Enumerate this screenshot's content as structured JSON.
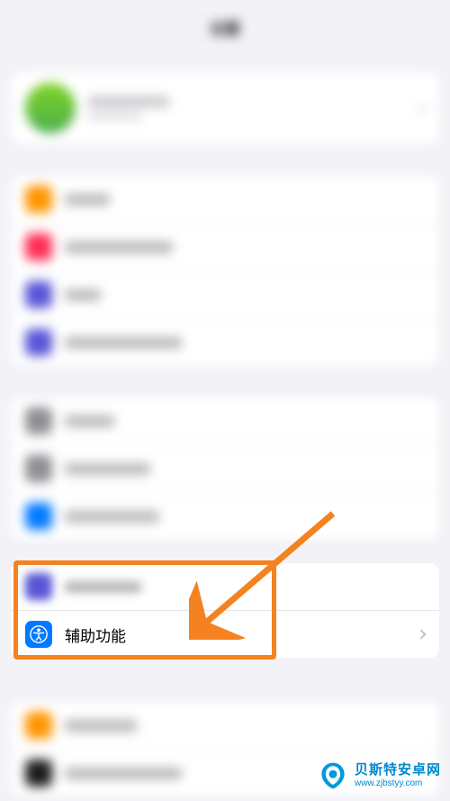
{
  "header": {
    "title": "设置"
  },
  "accessibility": {
    "label": "辅助功能",
    "icon_name": "accessibility-icon"
  },
  "highlight": {
    "color": "#f58220"
  },
  "watermark": {
    "name": "贝斯特安卓网",
    "url": "www.zjbstyy.com"
  },
  "blurred_icons": {
    "group1": [
      "#ff9500",
      "#ff2d55",
      "#5856d6",
      "#5856d6"
    ],
    "group2": [
      "#8e8e93",
      "#8e8e93",
      "#007aff"
    ],
    "sharp_blurred": "#5856d6",
    "group3": [
      "#ff9500",
      "#1c1c1e"
    ]
  }
}
